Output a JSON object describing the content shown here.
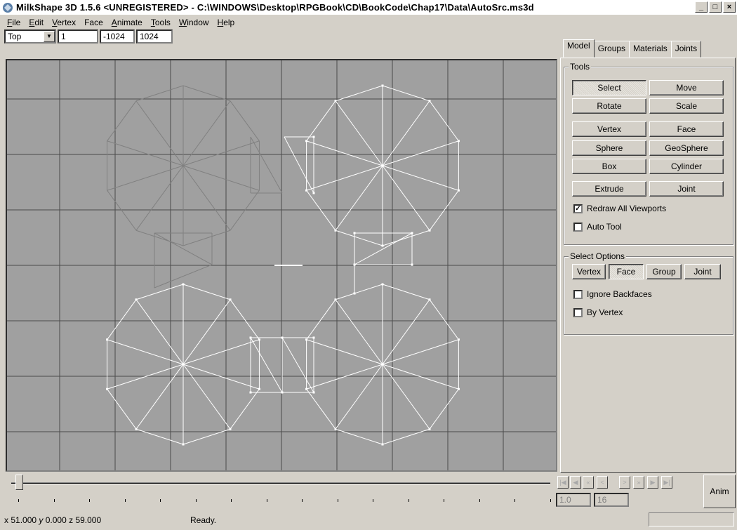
{
  "window": {
    "title": "MilkShape 3D 1.5.6 <UNREGISTERED> - C:\\WINDOWS\\Desktop\\RPGBook\\CD\\BookCode\\Chap17\\Data\\AutoSrc.ms3d",
    "min_label": "_",
    "max_label": "□",
    "close_label": "×"
  },
  "menu": [
    {
      "label": "File",
      "u": "F",
      "rest": "ile"
    },
    {
      "label": "Edit",
      "u": "E",
      "rest": "dit"
    },
    {
      "label": "Vertex",
      "u": "V",
      "rest": "ertex"
    },
    {
      "label": "Face",
      "u": "Fa",
      "rest": "ce"
    },
    {
      "label": "Animate",
      "u": "A",
      "rest": "nimate"
    },
    {
      "label": "Tools",
      "u": "T",
      "rest": "ools"
    },
    {
      "label": "Window",
      "u": "W",
      "rest": "indow"
    },
    {
      "label": "Help",
      "u": "H",
      "rest": "elp"
    }
  ],
  "toolbar": {
    "view": "Top",
    "zoom": "1",
    "min": "-1024",
    "max": "1024"
  },
  "tabs": [
    "Model",
    "Groups",
    "Materials",
    "Joints"
  ],
  "tools": {
    "label": "Tools",
    "buttons": [
      "Select",
      "Move",
      "Rotate",
      "Scale",
      "Vertex",
      "Face",
      "Sphere",
      "GeoSphere",
      "Box",
      "Cylinder",
      "Extrude",
      "Joint"
    ],
    "selected": "Select",
    "redraw_label": "Redraw All Viewports",
    "redraw_checked": true,
    "autotool_label": "Auto Tool",
    "autotool_checked": false
  },
  "select_options": {
    "label": "Select Options",
    "buttons": [
      "Vertex",
      "Face",
      "Group",
      "Joint"
    ],
    "selected": "Face",
    "ignore_backfaces_label": "Ignore Backfaces",
    "by_vertex_label": "By Vertex"
  },
  "anim": {
    "start_frame": "1.0",
    "end_frame": "16",
    "anim_label": "Anim",
    "nav": [
      "|<",
      "<",
      "<<",
      "<",
      ">",
      ">>",
      ">|",
      ">|"
    ]
  },
  "status": {
    "x_label": "x",
    "x": "51.000",
    "y_label": "y",
    "y": "0.000",
    "z_label": "z",
    "z": "59.000",
    "message": "Ready."
  },
  "colors": {
    "viewport_bg": "#a0a0a0",
    "grid": "#4a4a4a",
    "wire_selected": "#ffffff",
    "wire_unselected": "#808080"
  }
}
